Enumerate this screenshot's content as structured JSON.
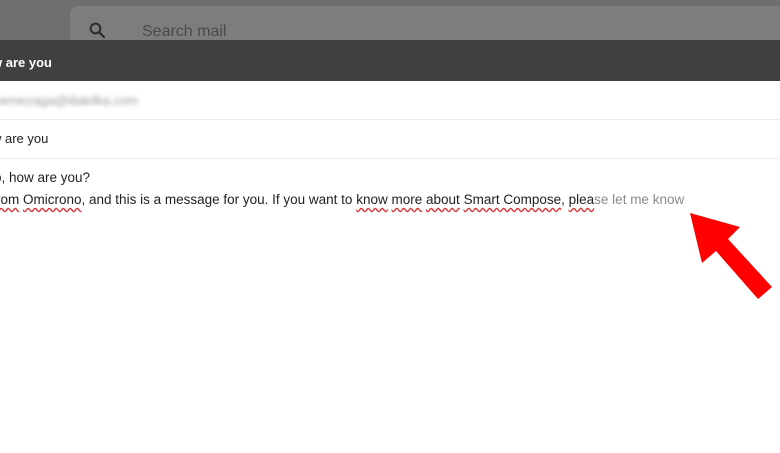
{
  "search": {
    "placeholder": "Search mail"
  },
  "compose": {
    "title": "w are you",
    "to": "hemezaga@iilakilka.com",
    "subject": "w are you",
    "body": {
      "line1": {
        "part_a": "o, how are you?"
      },
      "line2": {
        "w1": "rom",
        "w2": "Omicrono",
        "w3": ", and this is a message for you. If you want to",
        "w4": "know",
        "w5": "more",
        "w6": "about",
        "w7": "Smart Compose",
        "w8": ",",
        "w9": "plea",
        "suggestion": "se let me know"
      }
    }
  },
  "colors": {
    "header_bg": "#404040",
    "topbar_bg": "#6f6f6f",
    "arrow": "#ff0000"
  },
  "icons": {
    "search": "search-icon",
    "arrow": "red-arrow-annotation-icon"
  }
}
